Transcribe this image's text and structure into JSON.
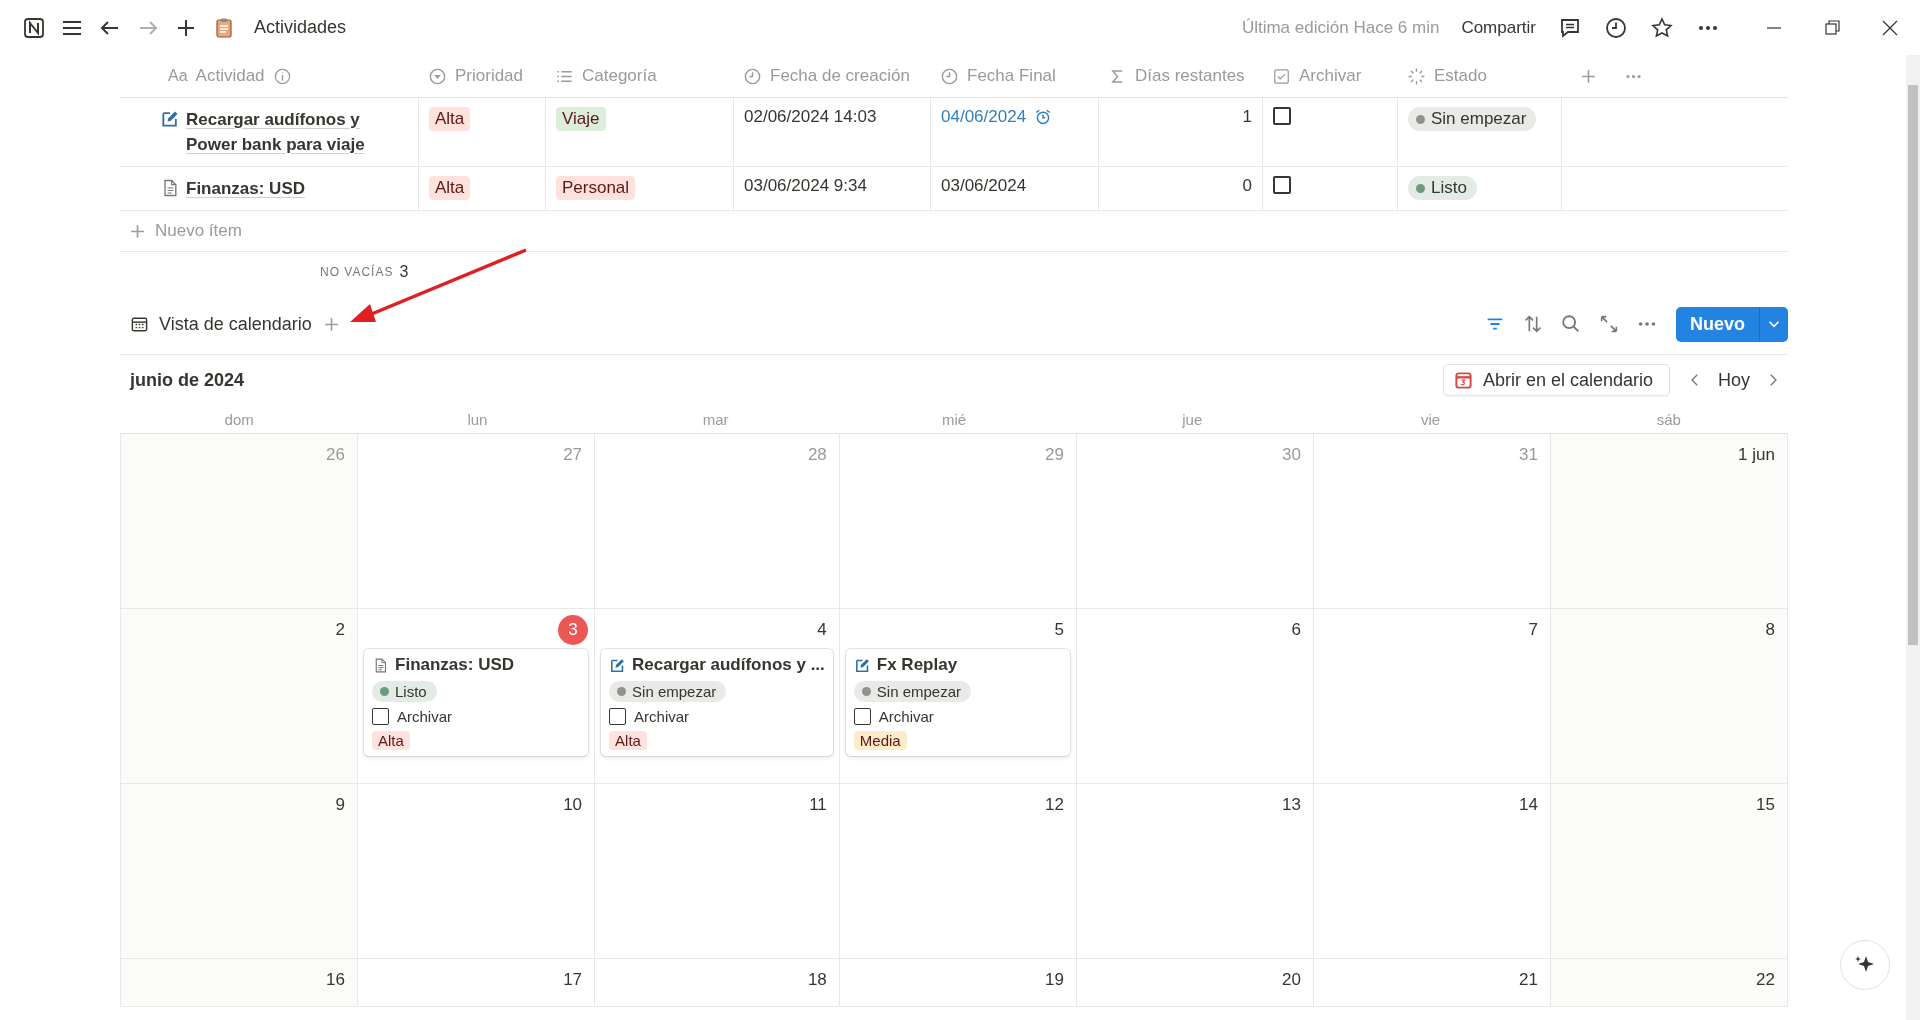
{
  "window": {
    "page_title": "Actividades",
    "last_edit": "Última edición Hace 6 min",
    "share": "Compartir"
  },
  "table": {
    "columns": [
      {
        "label": "Actividad",
        "kind": "title",
        "icon_text": "Aa"
      },
      {
        "label": "Prioridad",
        "kind": "select"
      },
      {
        "label": "Categoría",
        "kind": "multi"
      },
      {
        "label": "Fecha de creación",
        "kind": "created"
      },
      {
        "label": "Fecha Final",
        "kind": "date"
      },
      {
        "label": "Días restantes",
        "kind": "formula"
      },
      {
        "label": "Archivar",
        "kind": "checkbox"
      },
      {
        "label": "Estado",
        "kind": "status"
      }
    ],
    "rows": [
      {
        "title": "Recargar audífonos y Power bank para viaje",
        "kind": "edit",
        "priority": {
          "label": "Alta",
          "color": "#ffe2dd"
        },
        "category": {
          "label": "Viaje",
          "color": "#dbeddb"
        },
        "created": "02/06/2024 14:03",
        "due": {
          "text": "04/06/2024",
          "reminder": true
        },
        "days": "1",
        "archived": false,
        "status": {
          "label": "Sin empezar",
          "color": "#91918e"
        }
      },
      {
        "title": "Finanzas: USD",
        "kind": "page",
        "priority": {
          "label": "Alta",
          "color": "#ffe2dd"
        },
        "category": {
          "label": "Personal",
          "color": "#ffe2dd"
        },
        "created": "03/06/2024 9:34",
        "due": {
          "text": "03/06/2024",
          "reminder": false
        },
        "days": "0",
        "archived": false,
        "status": {
          "label": "Listo",
          "color": "#6c9b7d"
        }
      }
    ],
    "new_item": "Nuevo ítem",
    "summary": {
      "label": "NO VACÍAS",
      "value": "3"
    }
  },
  "calendar": {
    "view_tab": "Vista de calendario",
    "new_button": "Nuevo",
    "month": "junio de 2024",
    "open_button": "Abrir en el calendario",
    "today_button": "Hoy",
    "weekdays": [
      "dom",
      "lun",
      "mar",
      "mié",
      "jue",
      "vie",
      "sáb"
    ],
    "weeks": [
      [
        {
          "day": "26",
          "in_month": false
        },
        {
          "day": "27",
          "in_month": false
        },
        {
          "day": "28",
          "in_month": false
        },
        {
          "day": "29",
          "in_month": false
        },
        {
          "day": "30",
          "in_month": false
        },
        {
          "day": "31",
          "in_month": false
        },
        {
          "day": "1 jun",
          "in_month": true
        }
      ],
      [
        {
          "day": "2",
          "in_month": true
        },
        {
          "day": "3",
          "in_month": true,
          "today": true,
          "events": [
            {
              "title": "Finanzas: USD",
              "kind": "page",
              "status": {
                "label": "Listo",
                "color": "#6c9b7d"
              },
              "archive_label": "Archivar",
              "archived": false,
              "priority": {
                "label": "Alta",
                "color": "#ffe2dd"
              }
            }
          ]
        },
        {
          "day": "4",
          "in_month": true,
          "events": [
            {
              "title": "Recargar audífonos y ...",
              "kind": "edit",
              "status": {
                "label": "Sin empezar",
                "color": "#91918e"
              },
              "archive_label": "Archivar",
              "archived": false,
              "priority": {
                "label": "Alta",
                "color": "#ffe2dd"
              }
            }
          ]
        },
        {
          "day": "5",
          "in_month": true,
          "events": [
            {
              "title": "Fx Replay",
              "kind": "edit",
              "status": {
                "label": "Sin empezar",
                "color": "#91918e"
              },
              "archive_label": "Archivar",
              "archived": false,
              "priority": {
                "label": "Media",
                "color": "#fdecc8"
              }
            }
          ]
        },
        {
          "day": "6",
          "in_month": true
        },
        {
          "day": "7",
          "in_month": true
        },
        {
          "day": "8",
          "in_month": true
        }
      ],
      [
        {
          "day": "9",
          "in_month": true
        },
        {
          "day": "10",
          "in_month": true
        },
        {
          "day": "11",
          "in_month": true
        },
        {
          "day": "12",
          "in_month": true
        },
        {
          "day": "13",
          "in_month": true
        },
        {
          "day": "14",
          "in_month": true
        },
        {
          "day": "15",
          "in_month": true
        }
      ],
      [
        {
          "day": "16",
          "in_month": true
        },
        {
          "day": "17",
          "in_month": true
        },
        {
          "day": "18",
          "in_month": true
        },
        {
          "day": "19",
          "in_month": true
        },
        {
          "day": "20",
          "in_month": true
        },
        {
          "day": "21",
          "in_month": true
        },
        {
          "day": "22",
          "in_month": true
        }
      ]
    ]
  }
}
